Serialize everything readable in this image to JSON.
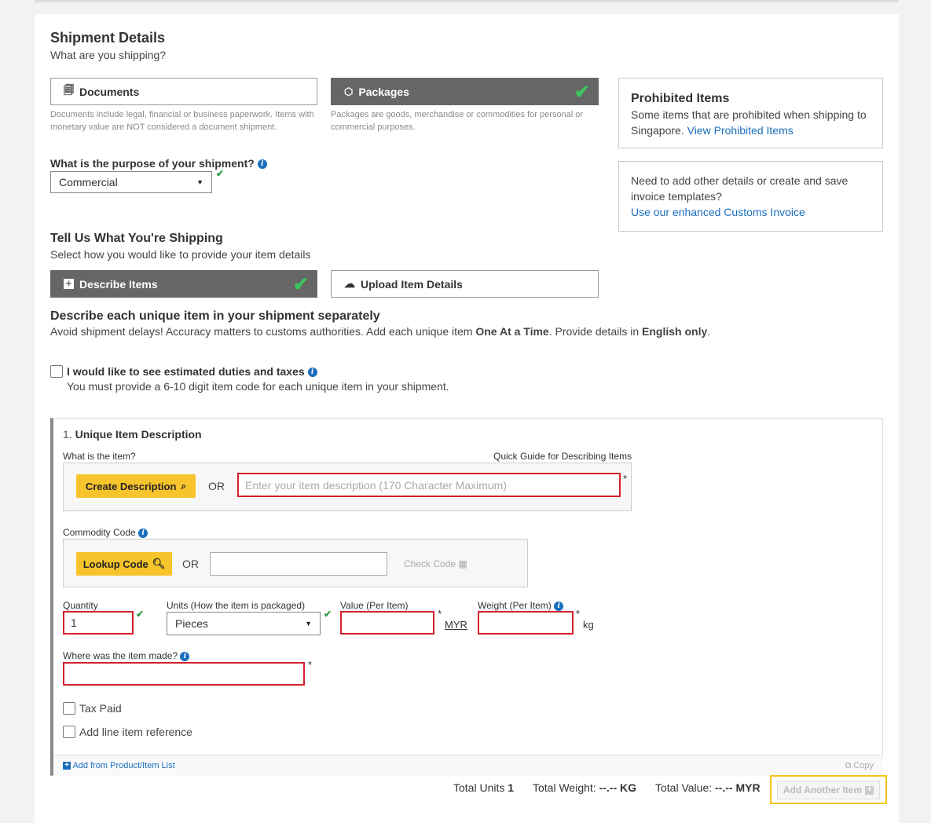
{
  "header": {
    "title": "Shipment Details",
    "subtitle": "What are you shipping?"
  },
  "shipment_type": {
    "documents_label": "Documents",
    "documents_desc": "Documents include legal, financial or business paperwork. Items with monetary value are NOT considered a document shipment.",
    "packages_label": "Packages",
    "packages_desc": "Packages are goods, merchandise or commodities for personal or commercial purposes.",
    "selected": "Packages"
  },
  "purpose": {
    "label": "What is the purpose of your shipment?",
    "value": "Commercial"
  },
  "prohibited": {
    "title": "Prohibited Items",
    "text": "Some items that are prohibited when shipping to Singapore.",
    "link": "View Prohibited Items"
  },
  "invoice_box": {
    "text": "Need to add other details or create and save invoice templates?",
    "link": "Use our enhanced Customs Invoice"
  },
  "tell_us": {
    "title": "Tell Us What You're Shipping",
    "subtitle": "Select how you would like to provide your item details",
    "describe_label": "Describe Items",
    "upload_label": "Upload Item Details"
  },
  "describe_section": {
    "title": "Describe each unique item in your shipment separately",
    "text_a": "Avoid shipment delays! Accuracy matters to customs authorities.  Add each unique item ",
    "text_b": "One At a Time",
    "text_c": ".  Provide details in ",
    "text_d": "English only",
    "text_e": "."
  },
  "duties": {
    "label": "I would like to see estimated duties and taxes",
    "note": "You must provide a 6-10 digit item code for each unique item in your shipment."
  },
  "item": {
    "number": "1.",
    "title": "Unique Item Description",
    "what_label": "What is the item?",
    "quick_guide": "Quick Guide for Describing Items",
    "create_btn": "Create Description",
    "or": "OR",
    "desc_placeholder": "Enter your item description (170 Character Maximum)",
    "commodity_label": "Commodity Code",
    "lookup_btn": "Lookup Code",
    "check_code": "Check Code",
    "quantity_label": "Quantity",
    "quantity_value": "1",
    "units_label": "Units (How the item is packaged)",
    "units_value": "Pieces",
    "value_label": "Value (Per Item)",
    "currency": "MYR",
    "weight_label": "Weight (Per Item)",
    "weight_unit": "kg",
    "made_label": "Where was the item made?",
    "tax_paid": "Tax Paid",
    "line_ref": "Add line item reference",
    "add_from_list": "Add from Product/Item List",
    "copy": "Copy",
    "required": "*"
  },
  "totals": {
    "units_label": "Total Units",
    "units_value": "1",
    "weight_label": "Total Weight:",
    "weight_value": "--.-- KG",
    "value_label": "Total Value:",
    "value_value": "--.-- MYR",
    "add_another": "Add Another Item"
  }
}
